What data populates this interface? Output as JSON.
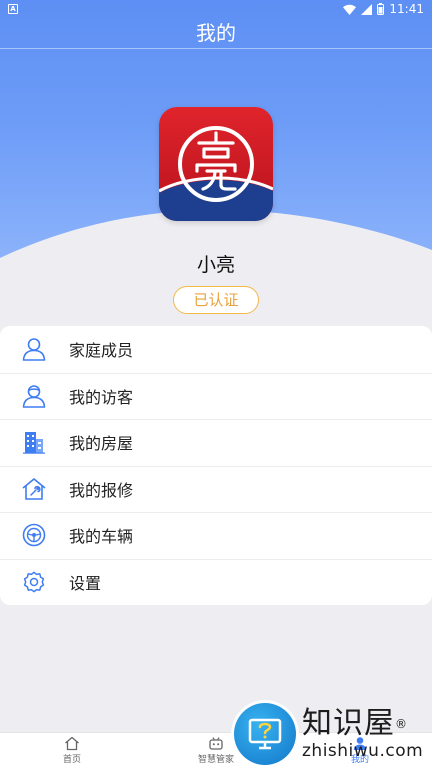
{
  "status_bar": {
    "notification": "A",
    "time": "11:41"
  },
  "header": {
    "title": "我的"
  },
  "profile": {
    "name": "小亮",
    "badge": "已认证"
  },
  "menu": [
    {
      "label": "家庭成员",
      "icon": "person-icon"
    },
    {
      "label": "我的访客",
      "icon": "visitor-icon"
    },
    {
      "label": "我的房屋",
      "icon": "building-icon"
    },
    {
      "label": "我的报修",
      "icon": "repair-house-icon"
    },
    {
      "label": "我的车辆",
      "icon": "steering-wheel-icon"
    },
    {
      "label": "设置",
      "icon": "gear-icon"
    }
  ],
  "bottom_nav": [
    {
      "label": "首页",
      "icon": "home-icon",
      "active": false
    },
    {
      "label": "智慧管家",
      "icon": "robot-icon",
      "active": false
    },
    {
      "label": "我的",
      "icon": "user-icon",
      "active": true
    }
  ],
  "watermark": {
    "cn": "知识屋",
    "reg": "®",
    "en": "zhishiwu.com"
  },
  "colors": {
    "accent": "#3f7df2",
    "header": "#6d9cf7",
    "badge": "#e9a23b",
    "icon": "#3f7df2"
  }
}
